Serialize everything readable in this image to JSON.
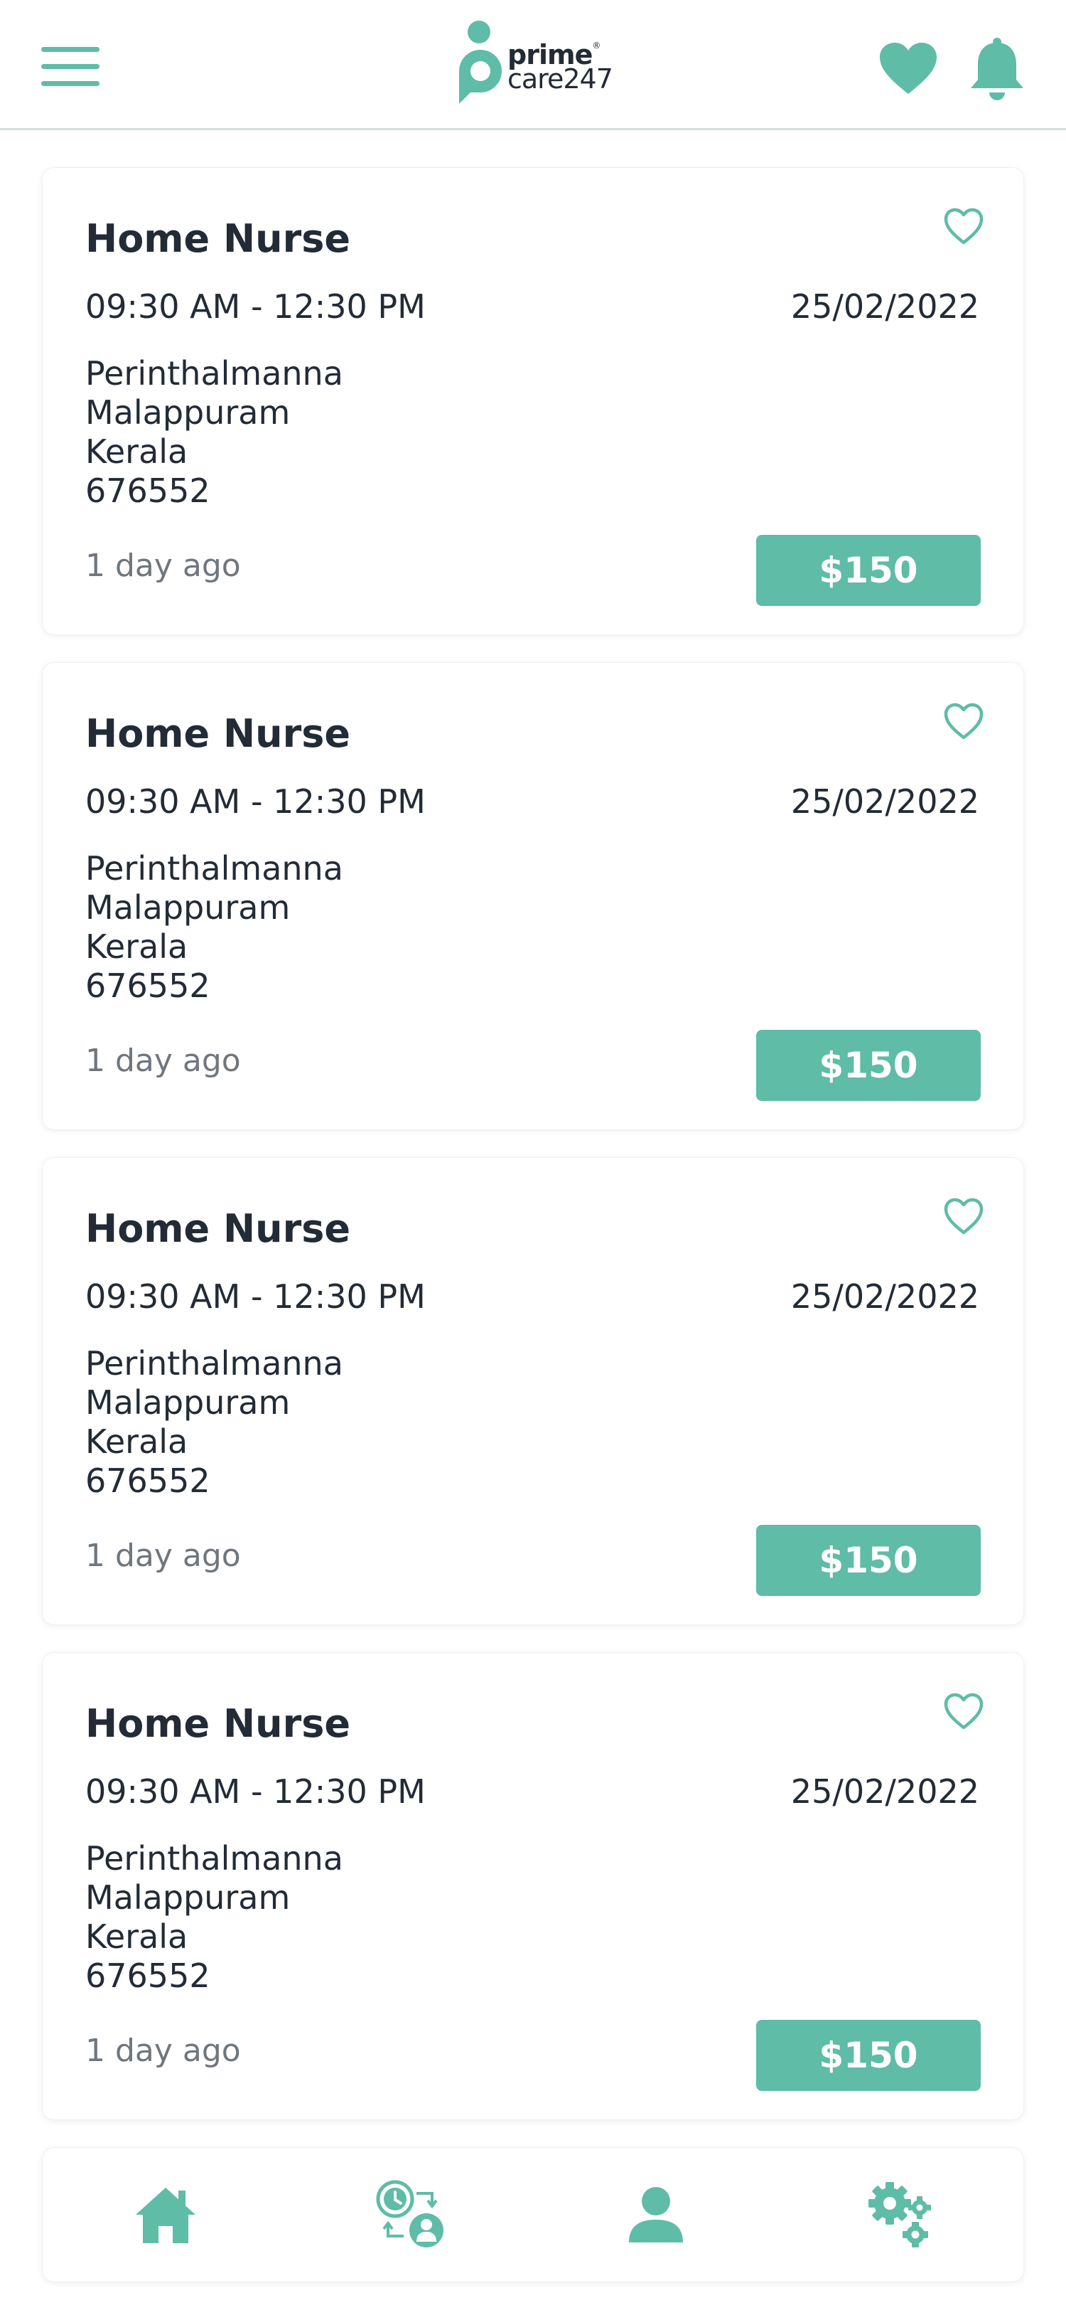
{
  "header": {
    "menu_icon": "hamburger-menu-icon",
    "logo": {
      "line1": "prime",
      "line2": "care247",
      "registered": "®"
    },
    "favorites_icon": "heart-filled-icon",
    "notifications_icon": "bell-icon"
  },
  "colors": {
    "accent": "#5fbca6",
    "text": "#222b36",
    "muted": "#6f767d",
    "divider": "#cfe1dc"
  },
  "jobs": [
    {
      "title": "Home Nurse",
      "time": "09:30 AM - 12:30 PM",
      "date": "25/02/2022",
      "address": [
        "Perinthalmanna",
        "Malappuram",
        "Kerala",
        "676552"
      ],
      "posted": "1 day ago",
      "price": "$150",
      "favorite_icon": "heart-outline-icon"
    },
    {
      "title": "Home Nurse",
      "time": "09:30 AM - 12:30 PM",
      "date": "25/02/2022",
      "address": [
        "Perinthalmanna",
        "Malappuram",
        "Kerala",
        "676552"
      ],
      "posted": "1 day ago",
      "price": "$150",
      "favorite_icon": "heart-outline-icon"
    },
    {
      "title": "Home Nurse",
      "time": "09:30 AM - 12:30 PM",
      "date": "25/02/2022",
      "address": [
        "Perinthalmanna",
        "Malappuram",
        "Kerala",
        "676552"
      ],
      "posted": "1 day ago",
      "price": "$150",
      "favorite_icon": "heart-outline-icon"
    },
    {
      "title": "Home Nurse",
      "time": "09:30 AM - 12:30 PM",
      "date": "25/02/2022",
      "address": [
        "Perinthalmanna",
        "Malappuram",
        "Kerala",
        "676552"
      ],
      "posted": "1 day ago",
      "price": "$150",
      "favorite_icon": "heart-outline-icon"
    }
  ],
  "bottom_nav": {
    "items": [
      {
        "icon": "home-icon"
      },
      {
        "icon": "schedule-exchange-icon"
      },
      {
        "icon": "user-profile-icon"
      },
      {
        "icon": "settings-gears-icon"
      }
    ]
  }
}
